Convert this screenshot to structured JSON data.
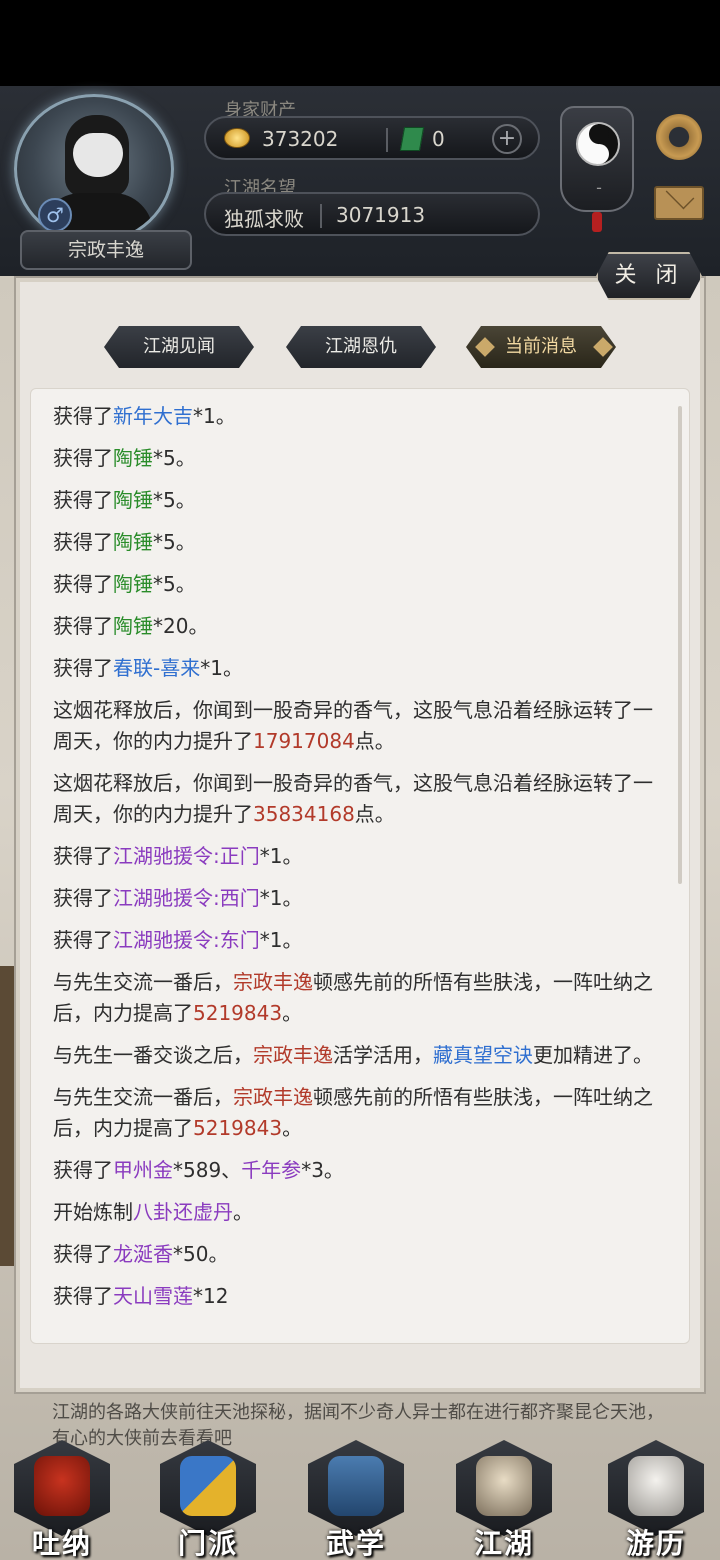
{
  "header": {
    "wealth_label": "身家财产",
    "gold_value": "373202",
    "jade_value": "0",
    "plus_label": "+",
    "reputation_label": "江湖名望",
    "title_value": "独孤求败",
    "reputation_value": "3071913",
    "gender_symbol": "♂",
    "player_name": "宗政丰逸",
    "badge_label": "-"
  },
  "dialog": {
    "close_label": "关 闭",
    "tabs": [
      {
        "label": "江湖见闻"
      },
      {
        "label": "江湖恩仇"
      },
      {
        "label": "当前消息"
      }
    ],
    "active_tab": 2
  },
  "log": [
    [
      {
        "t": "获得了",
        "c": "text"
      },
      {
        "t": "新年大吉",
        "c": "blue"
      },
      {
        "t": "*1。",
        "c": "text"
      }
    ],
    [
      {
        "t": "获得了",
        "c": "text"
      },
      {
        "t": "陶锤",
        "c": "green"
      },
      {
        "t": "*5。",
        "c": "text"
      }
    ],
    [
      {
        "t": "获得了",
        "c": "text"
      },
      {
        "t": "陶锤",
        "c": "green"
      },
      {
        "t": "*5。",
        "c": "text"
      }
    ],
    [
      {
        "t": "获得了",
        "c": "text"
      },
      {
        "t": "陶锤",
        "c": "green"
      },
      {
        "t": "*5。",
        "c": "text"
      }
    ],
    [
      {
        "t": "获得了",
        "c": "text"
      },
      {
        "t": "陶锤",
        "c": "green"
      },
      {
        "t": "*5。",
        "c": "text"
      }
    ],
    [
      {
        "t": "获得了",
        "c": "text"
      },
      {
        "t": "陶锤",
        "c": "green"
      },
      {
        "t": "*20。",
        "c": "text"
      }
    ],
    [
      {
        "t": "获得了",
        "c": "text"
      },
      {
        "t": "春联-喜来",
        "c": "blue"
      },
      {
        "t": "*1。",
        "c": "text"
      }
    ],
    [
      {
        "t": "这烟花释放后，你闻到一股奇异的香气，这股气息沿着经脉运转了一周天，你的内力提升了",
        "c": "text"
      },
      {
        "t": "17917084",
        "c": "red"
      },
      {
        "t": "点。",
        "c": "text"
      }
    ],
    [
      {
        "t": "这烟花释放后，你闻到一股奇异的香气，这股气息沿着经脉运转了一周天，你的内力提升了",
        "c": "text"
      },
      {
        "t": "35834168",
        "c": "red"
      },
      {
        "t": "点。",
        "c": "text"
      }
    ],
    [
      {
        "t": "获得了",
        "c": "text"
      },
      {
        "t": "江湖驰援令:正门",
        "c": "purple"
      },
      {
        "t": "*1。",
        "c": "text"
      }
    ],
    [
      {
        "t": "获得了",
        "c": "text"
      },
      {
        "t": "江湖驰援令:西门",
        "c": "purple"
      },
      {
        "t": "*1。",
        "c": "text"
      }
    ],
    [
      {
        "t": "获得了",
        "c": "text"
      },
      {
        "t": "江湖驰援令:东门",
        "c": "purple"
      },
      {
        "t": "*1。",
        "c": "text"
      }
    ],
    [
      {
        "t": "与先生交流一番后，",
        "c": "text"
      },
      {
        "t": "宗政丰逸",
        "c": "red"
      },
      {
        "t": "顿感先前的所悟有些肤浅，一阵吐纳之后，内力提高了",
        "c": "text"
      },
      {
        "t": "5219843",
        "c": "red"
      },
      {
        "t": "。",
        "c": "text"
      }
    ],
    [
      {
        "t": "与先生一番交谈之后，",
        "c": "text"
      },
      {
        "t": "宗政丰逸",
        "c": "red"
      },
      {
        "t": "活学活用，",
        "c": "text"
      },
      {
        "t": "藏真望空诀",
        "c": "blue"
      },
      {
        "t": "更加精进了。",
        "c": "text"
      }
    ],
    [
      {
        "t": "与先生交流一番后，",
        "c": "text"
      },
      {
        "t": "宗政丰逸",
        "c": "red"
      },
      {
        "t": "顿感先前的所悟有些肤浅，一阵吐纳之后，内力提高了",
        "c": "text"
      },
      {
        "t": "5219843",
        "c": "red"
      },
      {
        "t": "。",
        "c": "text"
      }
    ],
    [
      {
        "t": "获得了",
        "c": "text"
      },
      {
        "t": "甲州金",
        "c": "purple"
      },
      {
        "t": "*589、",
        "c": "text"
      },
      {
        "t": "千年参",
        "c": "purple"
      },
      {
        "t": "*3。",
        "c": "text"
      }
    ],
    [
      {
        "t": "开始炼制",
        "c": "text"
      },
      {
        "t": "八卦还虚丹",
        "c": "purple"
      },
      {
        "t": "。",
        "c": "text"
      }
    ],
    [
      {
        "t": "获得了",
        "c": "text"
      },
      {
        "t": "龙涎香",
        "c": "purple"
      },
      {
        "t": "*50。",
        "c": "text"
      }
    ],
    [
      {
        "t": "获得了",
        "c": "text"
      },
      {
        "t": "天山雪莲",
        "c": "purple"
      },
      {
        "t": "*12",
        "c": "text"
      }
    ]
  ],
  "background_text": "江湖的各路大侠前往天池探秘，据闻不少奇人异士都在进行都齐聚昆仑天池，有心的大侠前去看看吧",
  "nav": [
    {
      "label": "吐纳",
      "icon": "meditation-icon"
    },
    {
      "label": "门派",
      "icon": "sect-icon"
    },
    {
      "label": "武学",
      "icon": "martial-book-icon"
    },
    {
      "label": "江湖",
      "icon": "bamboo-hat-icon"
    },
    {
      "label": "游历",
      "icon": "horse-icon"
    }
  ],
  "colors": {
    "blue": "#2f6fd0",
    "green": "#2a8c2a",
    "purple": "#8a3bbf",
    "red": "#b23a2a",
    "text": "#2e2e2e"
  }
}
